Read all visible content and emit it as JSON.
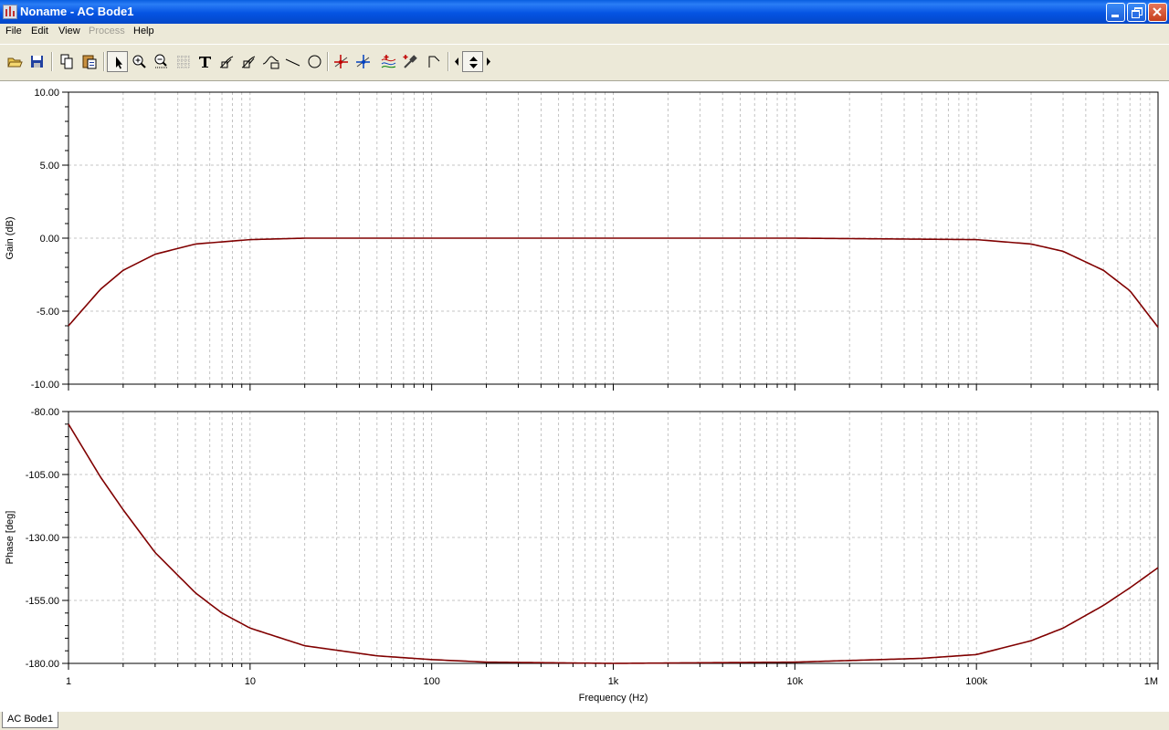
{
  "window": {
    "title": "Noname - AC Bode1"
  },
  "menu": [
    {
      "label": "File",
      "enabled": true
    },
    {
      "label": "Edit",
      "enabled": true
    },
    {
      "label": "View",
      "enabled": true
    },
    {
      "label": "Process",
      "enabled": false
    },
    {
      "label": "Help",
      "enabled": true
    }
  ],
  "toolbar": {
    "icons": [
      "open-folder-icon",
      "save-icon",
      "copy-icon",
      "paste-icon",
      "pointer-icon",
      "zoom-in-icon",
      "zoom-out-icon",
      "grid-icon",
      "text-icon",
      "label-icon",
      "label-alt-icon",
      "curve-label-icon",
      "line-icon",
      "circle-icon",
      "cursor-a-icon",
      "cursor-b-icon",
      "wave-icon",
      "probe-icon",
      "flag-icon",
      "arrow-left-icon",
      "arrow-updown-icon",
      "arrow-right-icon"
    ],
    "selected": "pointer-icon"
  },
  "tabs": [
    {
      "label": "AC Bode1",
      "active": true
    }
  ],
  "chart_data": [
    {
      "type": "line",
      "ylabel": "Gain (dB)",
      "xscale": "log",
      "xlim": [
        1,
        1000000
      ],
      "ylim": [
        -10,
        10
      ],
      "yticks": [
        "10.00",
        "5.00",
        "0.00",
        "-5.00",
        "-10.00"
      ],
      "grid": true,
      "series": [
        {
          "color": "#800000",
          "x": [
            1,
            1.5,
            2,
            3,
            5,
            10,
            20,
            50,
            100,
            1000,
            10000,
            100000,
            200000,
            300000,
            500000,
            700000,
            1000000
          ],
          "y": [
            -6.0,
            -3.5,
            -2.2,
            -1.1,
            -0.4,
            -0.1,
            0.0,
            0.0,
            0.0,
            0.0,
            0.0,
            -0.1,
            -0.4,
            -0.9,
            -2.2,
            -3.6,
            -6.1
          ]
        }
      ]
    },
    {
      "type": "line",
      "xlabel": "Frequency (Hz)",
      "ylabel": "Phase [deg]",
      "xscale": "log",
      "xlim": [
        1,
        1000000
      ],
      "ylim": [
        -180,
        -80
      ],
      "yticks": [
        "-80.00",
        "-105.00",
        "-130.00",
        "-155.00",
        "-180.00"
      ],
      "xticks": [
        "1",
        "10",
        "100",
        "1k",
        "10k",
        "100k",
        "1M"
      ],
      "grid": true,
      "series": [
        {
          "color": "#800000",
          "x": [
            1,
            1.5,
            2,
            3,
            5,
            7,
            10,
            20,
            50,
            100,
            200,
            1000,
            10000,
            50000,
            100000,
            200000,
            300000,
            500000,
            700000,
            1000000
          ],
          "y": [
            -85,
            -106,
            -119,
            -136,
            -152,
            -160,
            -166,
            -173,
            -177,
            -178.5,
            -179.5,
            -180,
            -179.5,
            -178,
            -176.5,
            -171,
            -166,
            -157,
            -150,
            -142
          ]
        }
      ]
    }
  ]
}
